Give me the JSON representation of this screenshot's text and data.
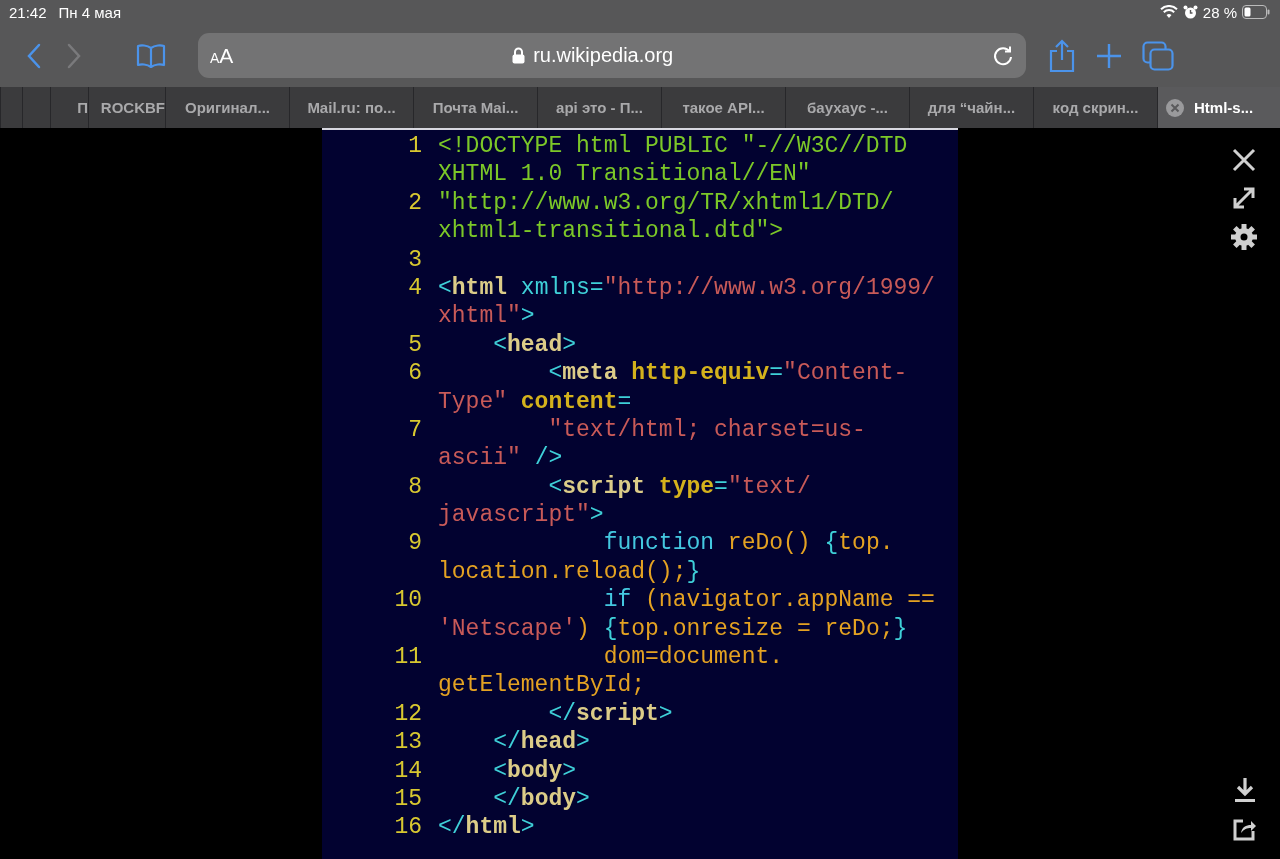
{
  "status_bar": {
    "time": "21:42",
    "date": "Пн 4 мая",
    "battery": "28 %"
  },
  "toolbar": {
    "nav_buttons": [
      {
        "kind": "back",
        "disabled": false
      },
      {
        "kind": "forward",
        "disabled": true
      }
    ],
    "address": {
      "text_size_button": "AA",
      "url": "ru.wikipedia.org"
    }
  },
  "tabs": [
    {
      "kind": "collapsed",
      "selected": false
    },
    {
      "kind": "collapsed",
      "selected": false
    },
    {
      "kind": "collapsed",
      "label": "П",
      "selected": false
    },
    {
      "kind": "collapsed",
      "label": "ROCKBF",
      "selected": false
    },
    {
      "kind": "normal",
      "label": "Оригинал...",
      "selected": false
    },
    {
      "kind": "normal",
      "label": "Mail.ru: по...",
      "selected": false
    },
    {
      "kind": "normal",
      "label": "Почта Mai...",
      "selected": false
    },
    {
      "kind": "normal",
      "label": "api это - П...",
      "selected": false
    },
    {
      "kind": "normal",
      "label": "такое API...",
      "selected": false
    },
    {
      "kind": "normal",
      "label": "баухаус -...",
      "selected": false
    },
    {
      "kind": "normal",
      "label": "для “чайн...",
      "selected": false
    },
    {
      "kind": "normal",
      "label": "код скрин...",
      "selected": false
    },
    {
      "kind": "normal",
      "label": "Html-s...",
      "selected": true
    }
  ],
  "code_image": {
    "rows": [
      {
        "number": "1",
        "tokens": [
          {
            "kind": "doctype",
            "text": "<!DOCTYPE html PUBLIC \"-//W3C//DTD"
          }
        ]
      },
      {
        "tokens": [
          {
            "kind": "doctype",
            "text": "XHTML 1.0 Transitional//EN\""
          }
        ]
      },
      {
        "number": "2",
        "tokens": [
          {
            "kind": "doctype",
            "text": "\"http://www.w3.org/TR/xhtml1/DTD/"
          }
        ]
      },
      {
        "tokens": [
          {
            "kind": "doctype",
            "text": "xhtml1-transitional.dtd\">"
          }
        ]
      },
      {
        "number": "3",
        "tokens": []
      },
      {
        "number": "4",
        "tokens": [
          {
            "kind": "punct",
            "text": "<"
          },
          {
            "kind": "tag",
            "text": "html"
          },
          {
            "kind": "punct",
            "text": " xmlns="
          },
          {
            "kind": "string",
            "text": "\"http://www.w3.org/1999/"
          }
        ]
      },
      {
        "tokens": [
          {
            "kind": "string",
            "text": "xhtml\""
          },
          {
            "kind": "punct",
            "text": ">"
          }
        ]
      },
      {
        "number": "5",
        "tokens": [
          {
            "kind": "punct",
            "text": "    <"
          },
          {
            "kind": "tag",
            "text": "head"
          },
          {
            "kind": "punct",
            "text": ">"
          }
        ]
      },
      {
        "number": "6",
        "tokens": [
          {
            "kind": "punct",
            "text": "        <"
          },
          {
            "kind": "tag",
            "text": "meta"
          },
          {
            "kind": "attr",
            "text": " http-equiv"
          },
          {
            "kind": "punct",
            "text": "="
          },
          {
            "kind": "string",
            "text": "\"Content-"
          }
        ]
      },
      {
        "tokens": [
          {
            "kind": "string",
            "text": "Type\""
          },
          {
            "kind": "attr",
            "text": " content"
          },
          {
            "kind": "punct",
            "text": "="
          }
        ]
      },
      {
        "number": "7",
        "tokens": [
          {
            "kind": "string",
            "text": "        \"text/html; charset=us-"
          }
        ]
      },
      {
        "tokens": [
          {
            "kind": "string",
            "text": "ascii\""
          },
          {
            "kind": "punct",
            "text": " />"
          }
        ]
      },
      {
        "number": "8",
        "tokens": [
          {
            "kind": "punct",
            "text": "        <"
          },
          {
            "kind": "tag",
            "text": "script"
          },
          {
            "kind": "attr",
            "text": " type"
          },
          {
            "kind": "punct",
            "text": "="
          },
          {
            "kind": "string",
            "text": "\"text/"
          }
        ]
      },
      {
        "tokens": [
          {
            "kind": "string",
            "text": "javascript\""
          },
          {
            "kind": "punct",
            "text": ">"
          }
        ]
      },
      {
        "number": "9",
        "tokens": [
          {
            "kind": "keyword",
            "text": "            function"
          },
          {
            "kind": "ident",
            "text": " reDo()"
          },
          {
            "kind": "punct",
            "text": " {"
          },
          {
            "kind": "ident",
            "text": "top."
          }
        ]
      },
      {
        "tokens": [
          {
            "kind": "ident",
            "text": "location.reload();"
          },
          {
            "kind": "punct",
            "text": "}"
          }
        ]
      },
      {
        "number": "10",
        "tokens": [
          {
            "kind": "keyword",
            "text": "            if"
          },
          {
            "kind": "ident",
            "text": " (navigator.appName =="
          }
        ]
      },
      {
        "tokens": [
          {
            "kind": "string",
            "text": "'Netscape'"
          },
          {
            "kind": "ident",
            "text": ")"
          },
          {
            "kind": "punct",
            "text": " {"
          },
          {
            "kind": "ident",
            "text": "top.onresize = reDo;"
          },
          {
            "kind": "punct",
            "text": "}"
          }
        ]
      },
      {
        "number": "11",
        "tokens": [
          {
            "kind": "ident",
            "text": "            dom=document."
          }
        ]
      },
      {
        "tokens": [
          {
            "kind": "ident",
            "text": "getElementById;"
          }
        ]
      },
      {
        "number": "12",
        "tokens": [
          {
            "kind": "punct",
            "text": "        </"
          },
          {
            "kind": "tag",
            "text": "script"
          },
          {
            "kind": "punct",
            "text": ">"
          }
        ]
      },
      {
        "number": "13",
        "tokens": [
          {
            "kind": "punct",
            "text": "    </"
          },
          {
            "kind": "tag",
            "text": "head"
          },
          {
            "kind": "punct",
            "text": ">"
          }
        ]
      },
      {
        "number": "14",
        "tokens": [
          {
            "kind": "punct",
            "text": "    <"
          },
          {
            "kind": "tag",
            "text": "body"
          },
          {
            "kind": "punct",
            "text": ">"
          }
        ]
      },
      {
        "number": "15",
        "tokens": [
          {
            "kind": "punct",
            "text": "    </"
          },
          {
            "kind": "tag",
            "text": "body"
          },
          {
            "kind": "punct",
            "text": ">"
          }
        ]
      },
      {
        "number": "16",
        "tokens": [
          {
            "kind": "punct",
            "text": "</"
          },
          {
            "kind": "tag",
            "text": "html"
          },
          {
            "kind": "punct",
            "text": ">"
          }
        ]
      }
    ]
  }
}
